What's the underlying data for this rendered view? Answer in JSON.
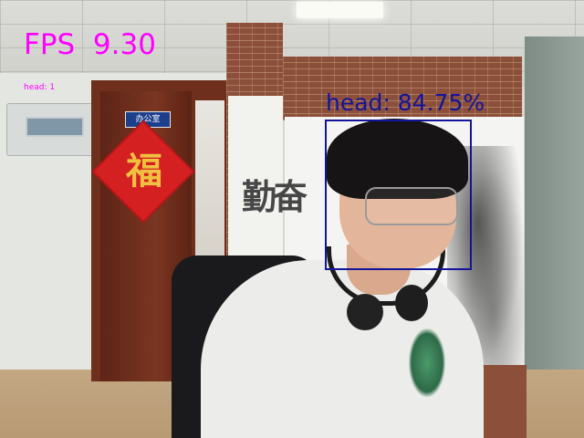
{
  "fps_overlay": {
    "label": "FPS",
    "value": "9.30",
    "color": "#ff00ff"
  },
  "class_info": {
    "text": "head: 1",
    "color": "#ff00ff"
  },
  "scene": {
    "door_sign_text": "办公室",
    "door_character": "福",
    "screen_calligraphy": "勤奋"
  },
  "detections": [
    {
      "class": "head",
      "confidence": "84.75%",
      "label": "head: 84.75%",
      "box_color": "#14149a"
    }
  ]
}
